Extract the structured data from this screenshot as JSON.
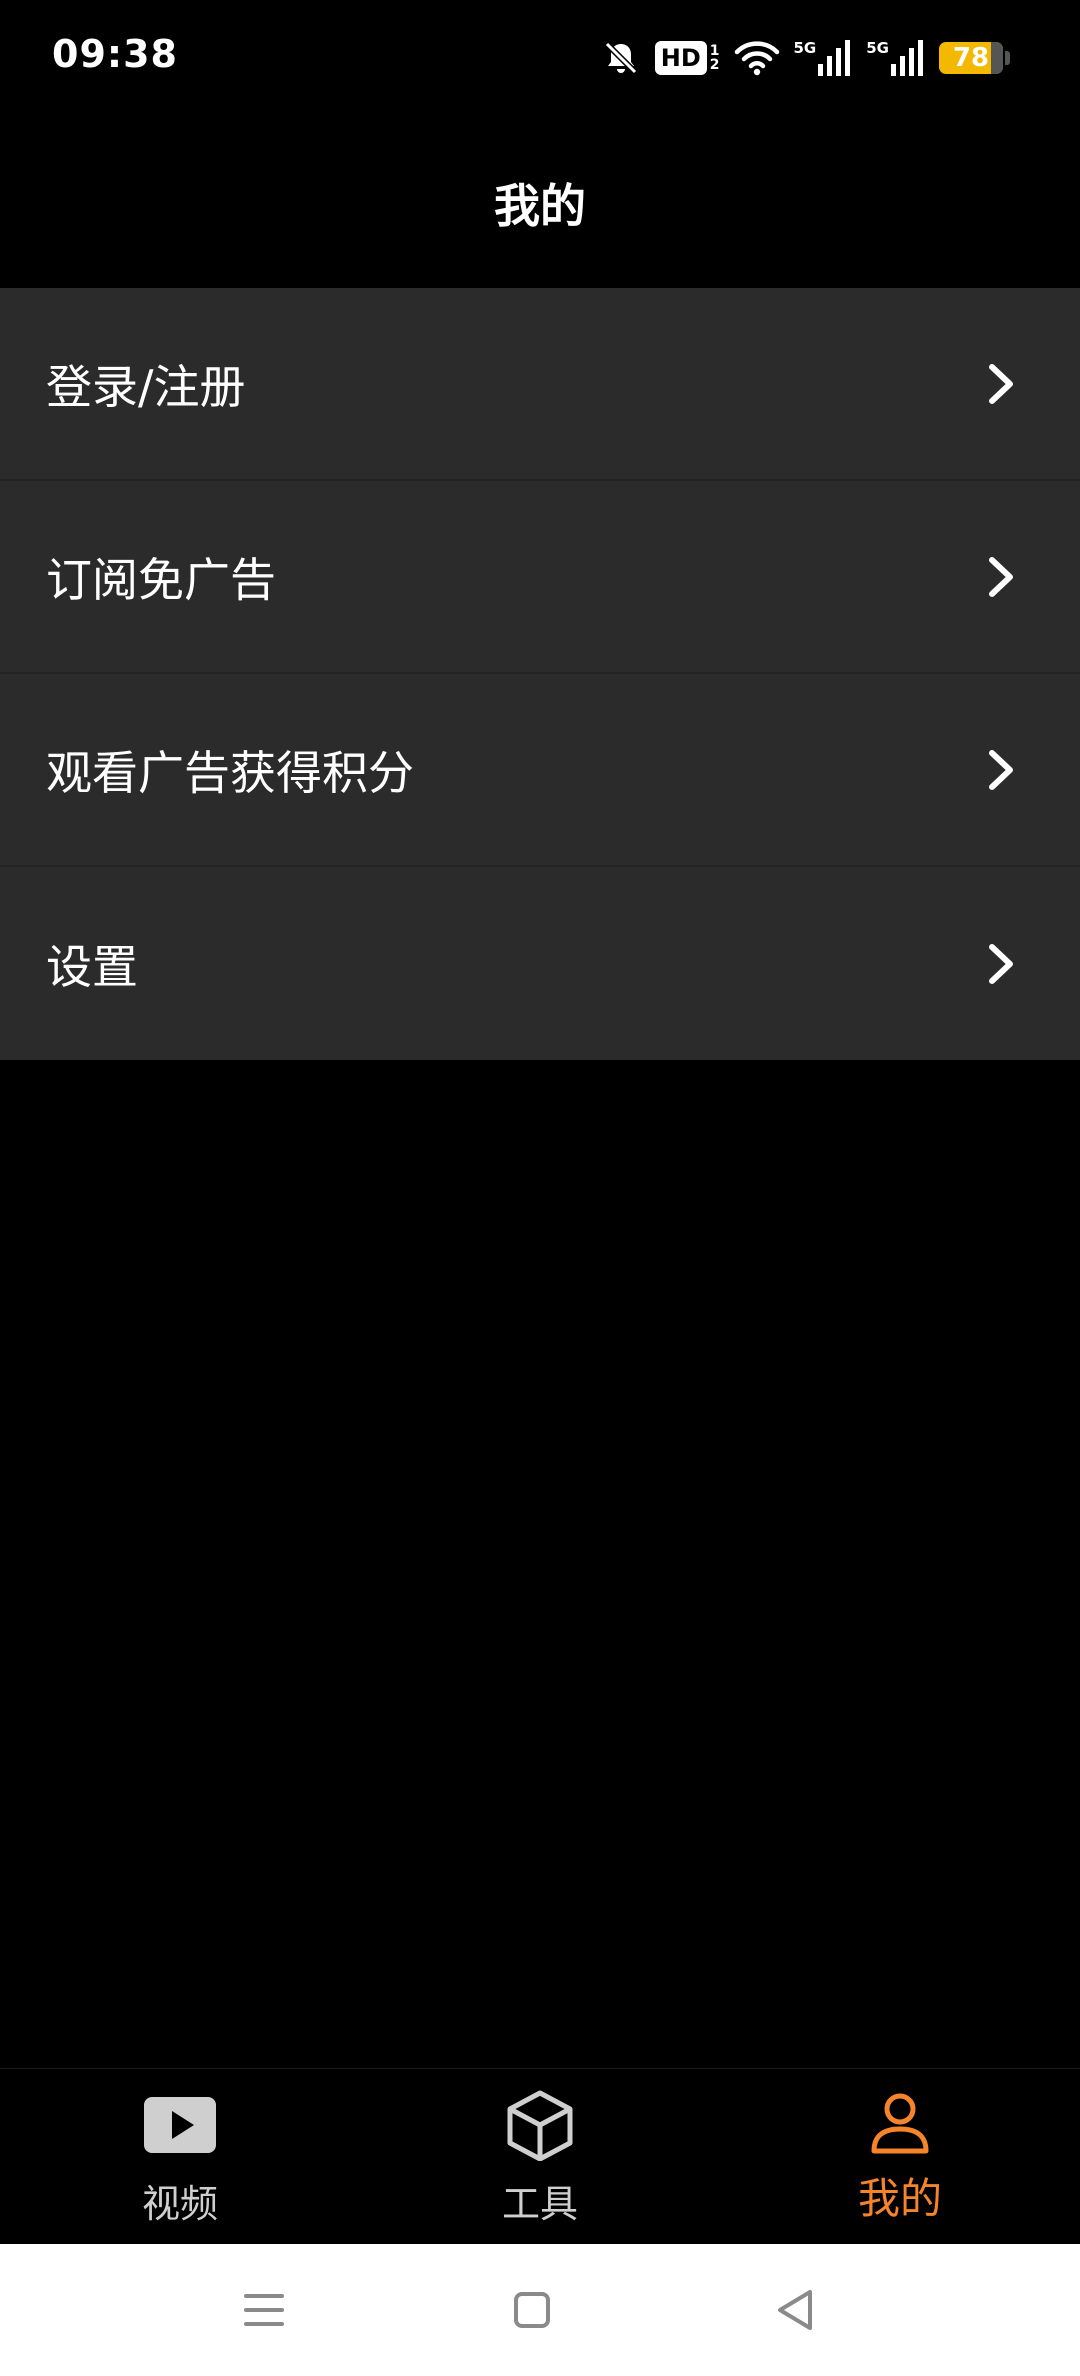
{
  "status_bar": {
    "time": "09:38",
    "hd_label": "HD",
    "hd_sub": [
      "1",
      "2"
    ],
    "signal1_label": "5G",
    "signal2_label": "5G",
    "battery_level": "78",
    "icons": [
      "bell-off-icon",
      "hd-icon",
      "wifi-icon",
      "signal-icon",
      "signal-icon",
      "battery-icon"
    ]
  },
  "header": {
    "title": "我的"
  },
  "menu": {
    "items": [
      {
        "label": "登录/注册",
        "icon": "chevron-right-icon"
      },
      {
        "label": "订阅免广告",
        "icon": "chevron-right-icon"
      },
      {
        "label": "观看广告获得积分",
        "icon": "chevron-right-icon"
      },
      {
        "label": "设置",
        "icon": "chevron-right-icon"
      }
    ]
  },
  "tab_bar": {
    "tabs": [
      {
        "label": "视频",
        "icon": "play-icon",
        "active": false
      },
      {
        "label": "工具",
        "icon": "cube-icon",
        "active": false
      },
      {
        "label": "我的",
        "icon": "user-icon",
        "active": true
      }
    ],
    "active_color": "#f6842a",
    "inactive_color": "#cfcfcf"
  },
  "system_nav": {
    "buttons": [
      "menu-icon",
      "home-icon",
      "back-icon"
    ]
  },
  "colors": {
    "background": "#000000",
    "menu_item_bg": "#2b2b2b",
    "accent": "#f6842a",
    "battery": "#f5b800"
  }
}
